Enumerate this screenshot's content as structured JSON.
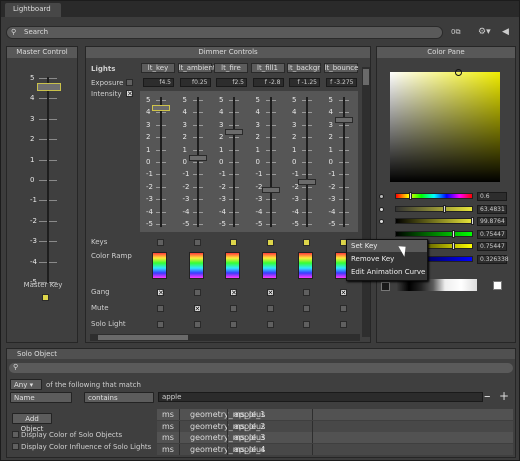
{
  "window": {
    "tab": "Lightboard"
  },
  "search": {
    "placeholder": "Search"
  },
  "toolbar": {
    "icons": [
      "filter-count-icon",
      "settings-icon",
      "collapse-icon"
    ]
  },
  "master": {
    "title": "Master Control",
    "ticks": [
      "5",
      "4",
      "3",
      "2",
      "1",
      "0",
      "-1",
      "-2",
      "-3",
      "-4",
      "-5"
    ],
    "label": "Master Key"
  },
  "dimmer": {
    "title": "Dimmer Controls",
    "row_lights": "Lights",
    "row_exposure": "Exposure",
    "row_intensity": "Intensity",
    "columns": [
      {
        "name": "lt_key",
        "exposure": "f4.5"
      },
      {
        "name": "lt_ambient",
        "exposure": "f0.25"
      },
      {
        "name": "lt_fire",
        "exposure": "f2.5"
      },
      {
        "name": "lt_fill1",
        "exposure": "f -2.8"
      },
      {
        "name": "lt_backgr",
        "exposure": "f -1.25"
      },
      {
        "name": "lt_bounce",
        "exposure": "f -3.275"
      }
    ],
    "ticks": [
      "5",
      "4",
      "3",
      "2",
      "1",
      "0",
      "-1",
      "-2",
      "-3",
      "-4",
      "-5"
    ],
    "row_keys": "Keys",
    "row_ramp": "Color Ramp",
    "row_gang": "Gang",
    "row_mute": "Mute",
    "row_solo": "Solo Light"
  },
  "color": {
    "title": "Color Pane",
    "values": [
      "0.6",
      "63.4831",
      "99.8764",
      "0.75447",
      "0.75447",
      "0.326338"
    ],
    "accent": "#e8e63a"
  },
  "context_menu": {
    "items": [
      "Set Key",
      "Remove Key",
      "Edit Animation Curve"
    ]
  },
  "solo": {
    "title": "Solo Object",
    "match_any": "Any",
    "match_text": "of the following that match",
    "field": "Name",
    "operator": "contains",
    "value": "apple",
    "add_button": "Add Object",
    "opt1": "Display Color of Solo Objects",
    "opt2": "Display Color Influence of Solo Lights",
    "rows": [
      [
        "ms",
        "geometry_ms_plus",
        "apple_1"
      ],
      [
        "ms",
        "geometry_ms_plus",
        "apple_2"
      ],
      [
        "ms",
        "geometry_ms_plus",
        "apple_3"
      ],
      [
        "ms",
        "geometry_ms_plus",
        "apple_4"
      ]
    ]
  }
}
